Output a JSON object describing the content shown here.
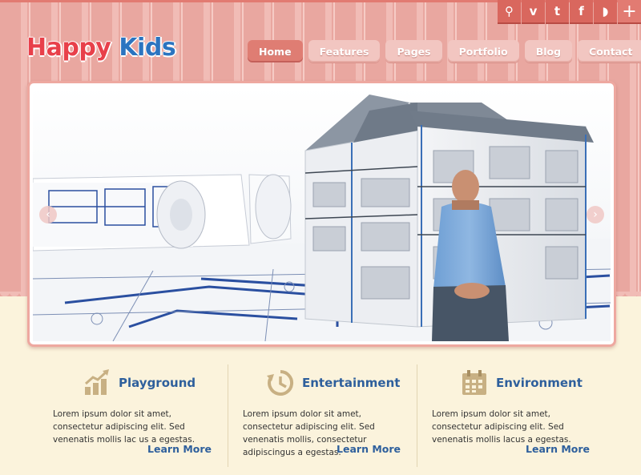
{
  "brand": {
    "word1": "Happy",
    "word2": "Kids",
    "color1": "#e8404a",
    "color2": "#2b74c0"
  },
  "social": [
    {
      "icon": "search-icon",
      "glyph": "⚲"
    },
    {
      "icon": "vimeo-icon",
      "glyph": "v"
    },
    {
      "icon": "twitter-icon",
      "glyph": "t"
    },
    {
      "icon": "facebook-icon",
      "glyph": "f"
    },
    {
      "icon": "rss-icon",
      "glyph": "◗"
    },
    {
      "icon": "plus-icon",
      "glyph": "+"
    }
  ],
  "nav": {
    "items": [
      {
        "label": "Home",
        "active": true
      },
      {
        "label": "Features",
        "active": false
      },
      {
        "label": "Pages",
        "active": false
      },
      {
        "label": "Portfolio",
        "active": false
      },
      {
        "label": "Blog",
        "active": false
      },
      {
        "label": "Contact",
        "active": false
      }
    ]
  },
  "slider": {
    "prev_glyph": "‹",
    "next_glyph": "›"
  },
  "features": [
    {
      "title": "Playground",
      "icon": "growth-chart-icon",
      "text": "Lorem ipsum dolor sit amet, consectetur adipiscing elit. Sed venenatis mollis lac us a egestas.",
      "link": "Learn More"
    },
    {
      "title": "Entertainment",
      "icon": "clock-icon",
      "text": "Lorem ipsum dolor sit amet, consectetur adipiscing elit. Sed venenatis mollis, consectetur adipiscingus a egestas.",
      "link": "Learn More"
    },
    {
      "title": "Environment",
      "icon": "calendar-icon",
      "text": "Lorem ipsum dolor sit amet, consectetur adipiscing elit. Sed venenatis mollis lacus a egestas.",
      "link": "Learn More"
    }
  ],
  "colors": {
    "accent": "#df7d73",
    "link": "#2e5f9c",
    "cream": "#fbf3dc",
    "icon": "#c8b083"
  }
}
